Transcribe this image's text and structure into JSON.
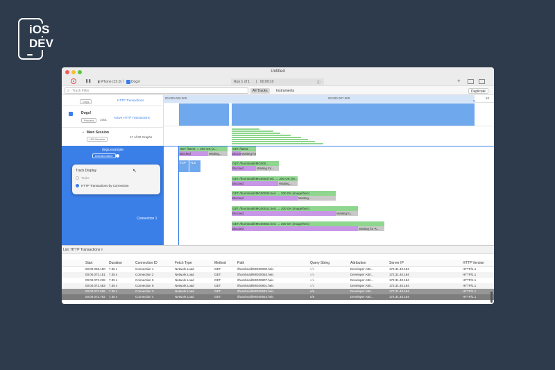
{
  "logo": {
    "line1": "iOS",
    "line2": "DEV"
  },
  "window": {
    "title": "Untitled"
  },
  "toolbar": {
    "device": "iPhone (15.0)",
    "app": "Dogs!",
    "run": "Run 1 of 1",
    "time": "00:00:10",
    "duplicate": "Duplicate"
  },
  "filter": {
    "placeholder": "Track Filter",
    "seg_all": "All Tracks",
    "seg_instruments": "Instruments"
  },
  "ruler": {
    "t0": "00.000.000.000",
    "t1": "00.000.007.000",
    "t2": "10."
  },
  "left": {
    "top_badge": "Dogs",
    "top_link": "HTTP Transactions",
    "app_name": "Dogs!",
    "app_badge": "Process",
    "app_pid": "1001",
    "app_track": "Active HTTP Transactions",
    "session_name": "Main Session",
    "session_badge": "URLSession",
    "session_count": "17 of 60 Graphs",
    "domain_title": "dogs.example",
    "domain_badge": "Domain Name",
    "connection": "Connection 1"
  },
  "popover": {
    "title": "Track Display",
    "opt1": "Tasks",
    "opt2": "HTTP Transactions by Connection"
  },
  "transactions": [
    {
      "get": "GET /latest → 200 OK (a...",
      "blocked": "Blocked",
      "waiting": "Waiting..."
    },
    {
      "get": "GET /thumbnail/IMG000...",
      "blocked": "Blocked",
      "waiting": "Waiting for..."
    },
    {
      "get": "GET /thumbnail/IMG0003.heic → 200 OK (im...",
      "blocked": "Blocked",
      "waiting": "Waiting..."
    },
    {
      "get": "GET /thumbnail/IMG00005.heic → 200 OK (image/heic)",
      "blocked": "Blocked",
      "waiting": "Waiting..."
    },
    {
      "get": "GET /thumbnail/IMG00041.heic → 200 OK (image/heic)",
      "blocked": "Blocked",
      "waiting": "Waiting fo..."
    },
    {
      "get": "GET /thumbnail/IMG00052.heic → 200 OK (image/heic)",
      "blocked": "Blocked",
      "waiting": "Waiting for R..."
    }
  ],
  "conn_labels": {
    "tcp": "TCP",
    "tls": "TLS",
    "get0": "GET /latest",
    "blocked0": "Blocked",
    "waiting0": "Waiting for..."
  },
  "bottom": {
    "list_label": "List: HTTP Transactions ◊"
  },
  "table": {
    "headers": [
      "Start",
      "Duration",
      "Connection ID",
      "Fetch Type",
      "Method",
      "Path",
      "Query String",
      "Attribution",
      "Server IP",
      "HTTP Version"
    ],
    "rows": [
      [
        "00:00.068.190",
        "7.35 s",
        "Connection 1",
        "Network Load",
        "GET",
        "/thumbnail/IMG00000.heic",
        "n/a",
        "Developer Attri...",
        "172.31.40.184",
        "HTTP/1.1"
      ],
      [
        "00:00.072.151",
        "7.35 s",
        "Connection 2",
        "Network Load",
        "GET",
        "/thumbnail/IMG00063.heic",
        "n/a",
        "Developer Attri...",
        "172.31.40.184",
        "HTTP/1.1"
      ],
      [
        "00:00.072.238",
        "7.35 s",
        "Connection 5",
        "Network Load",
        "GET",
        "/thumbnail/IMG00807.heic",
        "n/a",
        "Developer Attri...",
        "172.31.40.184",
        "HTTP/1.1"
      ],
      [
        "00:00.072.483",
        "7.35 s",
        "Connection 6",
        "Network Load",
        "GET",
        "/thumbnail/IMG00901.heic",
        "n/a",
        "Developer Attri...",
        "172.31.40.184",
        "HTTP/1.1"
      ],
      [
        "00:00.072.565",
        "7.35 s",
        "Connection 3",
        "Network Load",
        "GET",
        "/thumbnail/IMG00945.heic",
        "n/a",
        "Developer Attri...",
        "172.31.40.184",
        "HTTP/1.1"
      ],
      [
        "00:00.072.782",
        "7.35 s",
        "Connection 4",
        "Network Load",
        "GET",
        "/thumbnail/IMG00924.heic",
        "n/a",
        "Developer Attri...",
        "172.31.40.184",
        "HTTP/1.1"
      ]
    ]
  },
  "colors": {
    "accent": "#3a7ee8",
    "graph": "#6fa8ec",
    "green": "#8fd68f",
    "purple": "#c896e6",
    "gray": "#c9c9c9",
    "bg": "#2e3b4d"
  }
}
